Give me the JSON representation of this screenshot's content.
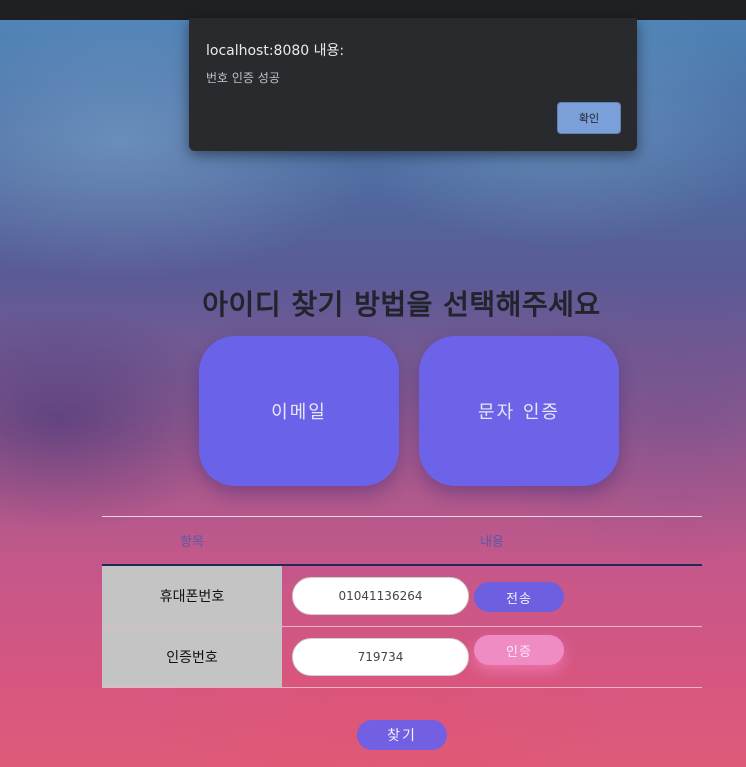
{
  "dialog": {
    "title": "localhost:8080 내용:",
    "message": "번호 인증 성공",
    "ok_label": "확인"
  },
  "page": {
    "title": "아이디 찾기 방법을 선택해주세요"
  },
  "methods": {
    "email_label": "이메일",
    "sms_label": "문자 인증"
  },
  "table": {
    "headers": [
      "항목",
      "내용"
    ],
    "phone": {
      "label": "휴대폰번호",
      "value": "01041136264",
      "button_label": "전송"
    },
    "code": {
      "label": "인증번호",
      "value": "719734",
      "button_label": "인증"
    }
  },
  "find_button_label": "찾기",
  "colors": {
    "method_button": "#6a63ea",
    "send_button": "#6e5fe0",
    "verify_button": "#ef8cc4",
    "dialog_ok": "#8ab4f8"
  }
}
